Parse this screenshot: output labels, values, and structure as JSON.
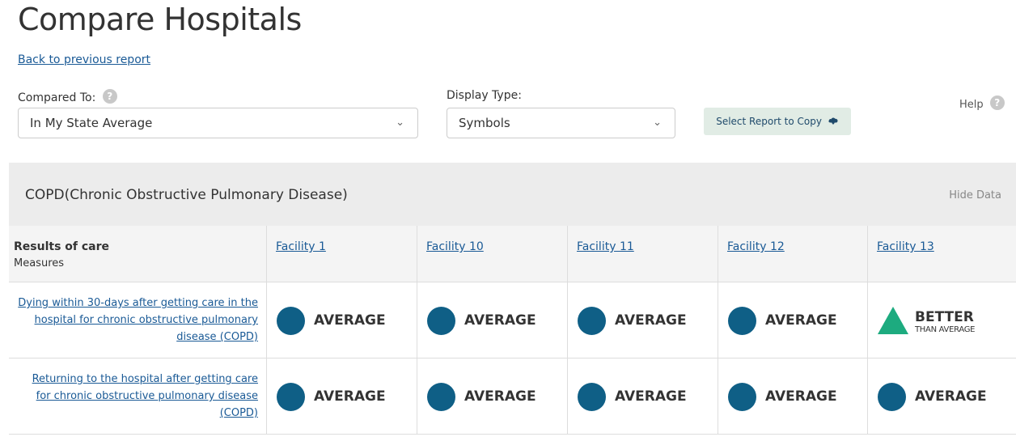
{
  "page": {
    "title": "Compare Hospitals",
    "back_link": "Back to previous report"
  },
  "filters": {
    "compared_to": {
      "label": "Compared To:",
      "value": "In My State Average"
    },
    "display_type": {
      "label": "Display Type:",
      "value": "Symbols"
    },
    "copy_button": "Select Report to Copy",
    "help_label": "Help"
  },
  "section": {
    "title": "COPD(Chronic Obstructive Pulmonary Disease)",
    "hide_data": "Hide Data"
  },
  "table": {
    "header_main": "Results of care",
    "header_sub": "Measures",
    "facilities": [
      "Facility 1",
      "Facility 10",
      "Facility 11",
      "Facility 12",
      "Facility 13"
    ],
    "rows": [
      {
        "measure": "Dying within 30-days after getting care in the hospital for chronic obstructive pulmonary disease (COPD)",
        "results": [
          {
            "symbol": "circle",
            "label": "AVERAGE"
          },
          {
            "symbol": "circle",
            "label": "AVERAGE"
          },
          {
            "symbol": "circle",
            "label": "AVERAGE"
          },
          {
            "symbol": "circle",
            "label": "AVERAGE"
          },
          {
            "symbol": "triangle-up",
            "label": "BETTER",
            "sublabel": "THAN AVERAGE"
          }
        ]
      },
      {
        "measure": "Returning to the hospital after getting care for chronic obstructive pulmonary disease (COPD)",
        "results": [
          {
            "symbol": "circle",
            "label": "AVERAGE"
          },
          {
            "symbol": "circle",
            "label": "AVERAGE"
          },
          {
            "symbol": "circle",
            "label": "AVERAGE"
          },
          {
            "symbol": "circle",
            "label": "AVERAGE"
          },
          {
            "symbol": "circle",
            "label": "AVERAGE"
          }
        ]
      }
    ]
  },
  "colors": {
    "average": "#0f5f86",
    "better": "#1dab7f",
    "link": "#1a5a96"
  },
  "icons": {
    "info": "question-circle-icon",
    "dropdown": "chevron-down-icon",
    "copy": "cloud-download-icon"
  }
}
